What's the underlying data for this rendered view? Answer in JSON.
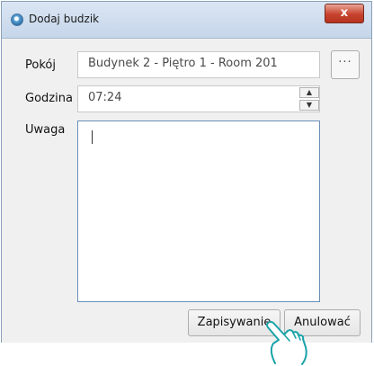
{
  "window": {
    "title": "Dodaj budzik",
    "close_symbol": "x"
  },
  "form": {
    "room_label": "Pokój",
    "room_value": "Budynek 2 - Piętro 1 - Room 201",
    "browse_label": "···",
    "time_label": "Godzina",
    "time_value": "07:24",
    "note_label": "Uwaga",
    "note_value": ""
  },
  "buttons": {
    "save_label": "Zapisywanie",
    "cancel_label": "Anulować"
  },
  "icons": {
    "app": "alarm-app-icon",
    "pointer": "hand-pointer-icon",
    "spin_up": "▲",
    "spin_down": "▼"
  }
}
